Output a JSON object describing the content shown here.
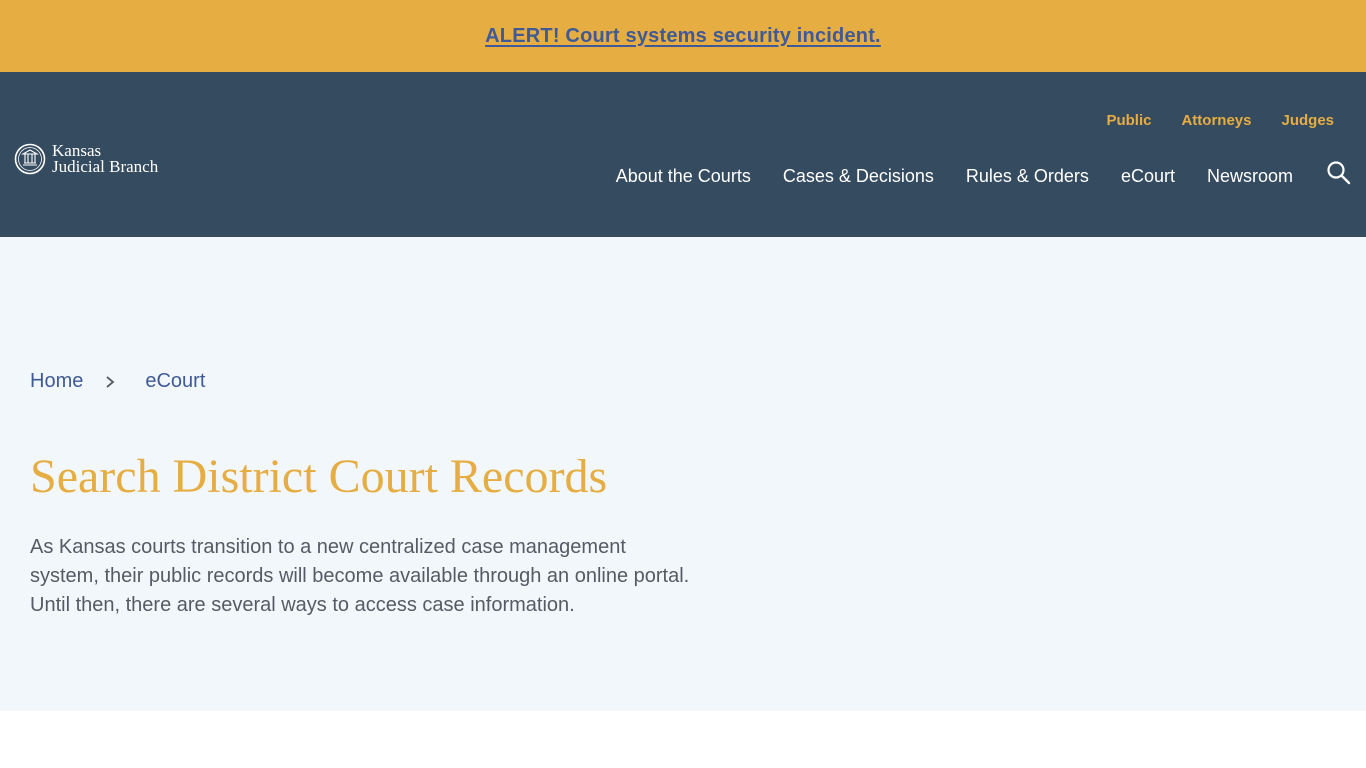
{
  "alert": {
    "text": "ALERT! Court systems security incident."
  },
  "logo": {
    "line1": "Kansas",
    "line2": "Judicial Branch",
    "icon": "court-seal-icon"
  },
  "audience_nav": [
    "Public",
    "Attorneys",
    "Judges"
  ],
  "main_nav": [
    "About the Courts",
    "Cases & Decisions",
    "Rules & Orders",
    "eCourt",
    "Newsroom"
  ],
  "search": {
    "icon": "search-icon"
  },
  "breadcrumb": {
    "items": [
      "Home",
      "eCourt"
    ],
    "separator_icon": "chevron-right-icon"
  },
  "page": {
    "title": "Search District Court Records",
    "intro": "As Kansas courts transition to a new centralized case management system, their public records will become available through an online portal. Until then, there are several ways to access case information."
  },
  "colors": {
    "alert_bg": "#e6ad42",
    "link_blue": "#3f5a96",
    "header_bg": "#354b60",
    "accent_gold": "#e6ad42",
    "hero_bg": "#f2f7fc",
    "body_text": "#555b63"
  }
}
